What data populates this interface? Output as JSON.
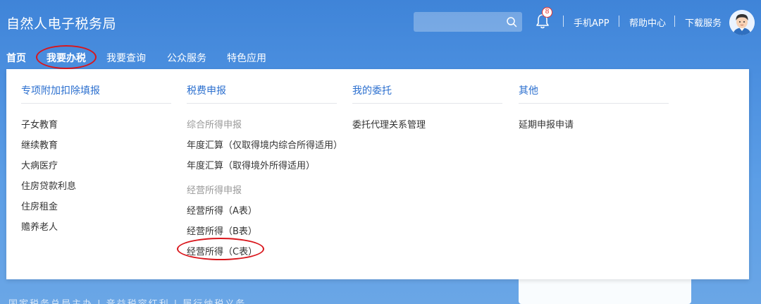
{
  "header": {
    "title": "自然人电子税务局",
    "search_placeholder": "",
    "notification_count": "8",
    "links": [
      "手机APP",
      "帮助中心",
      "下载服务"
    ]
  },
  "nav": {
    "items": [
      "首页",
      "我要办税",
      "我要查询",
      "公众服务",
      "特色应用"
    ],
    "active": "我要办税"
  },
  "menu": {
    "col1": {
      "heading": "专项附加扣除填报",
      "items": [
        "子女教育",
        "继续教育",
        "大病医疗",
        "住房贷款利息",
        "住房租金",
        "赡养老人"
      ]
    },
    "col2": {
      "heading": "税费申报",
      "sub1": "综合所得申报",
      "sub1_items": [
        "年度汇算（仅取得境内综合所得适用）",
        "年度汇算（取得境外所得适用）"
      ],
      "sub2": "经营所得申报",
      "sub2_items": [
        "经营所得（A表）",
        "经营所得（B表）",
        "经营所得（C表）"
      ]
    },
    "col3": {
      "heading": "我的委托",
      "items": [
        "委托代理关系管理"
      ]
    },
    "col4": {
      "heading": "其他",
      "items": [
        "延期申报申请"
      ]
    }
  },
  "background": {
    "slogan": "国家税务总局主办  |  音益税容红利  |  履行纳税义务"
  },
  "colors": {
    "header_bg": "#4a8ede",
    "menu_heading": "#2b6fcf",
    "highlight": "#d9161c"
  }
}
